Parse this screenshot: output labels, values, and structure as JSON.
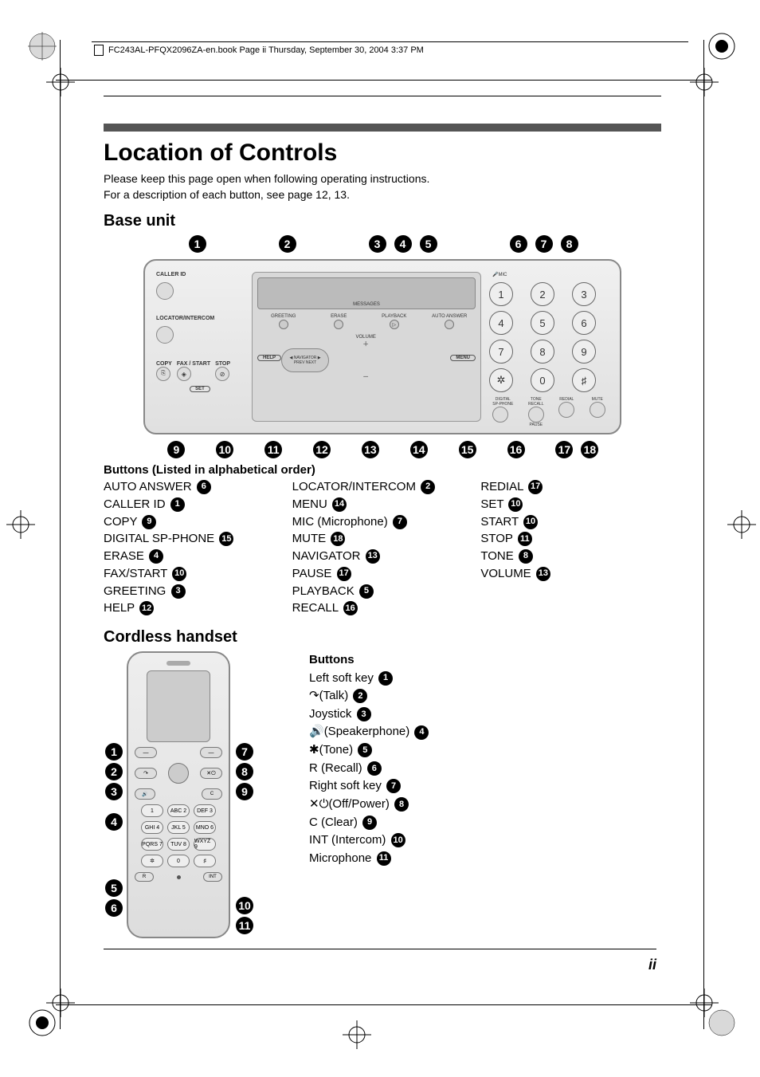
{
  "header": {
    "text": "FC243AL-PFQX2096ZA-en.book  Page ii  Thursday, September 30, 2004  3:37 PM"
  },
  "title": "Location of Controls",
  "intro_line1": "Please keep this page open when following operating instructions.",
  "intro_line2": "For a description of each button, see page 12, 13.",
  "base_unit": {
    "heading": "Base unit",
    "callouts_top": [
      "1",
      "2",
      "3",
      "4",
      "5",
      "6",
      "7",
      "8"
    ],
    "callouts_bottom": [
      "9",
      "10",
      "11",
      "12",
      "13",
      "14",
      "15",
      "16",
      "17",
      "18"
    ],
    "device_labels": {
      "caller_id": "CALLER ID",
      "locator_intercom": "LOCATOR/INTERCOM",
      "copy": "COPY",
      "fax_start": "FAX / START",
      "stop": "STOP",
      "set": "SET",
      "messages": "MESSAGES",
      "greeting": "GREETING",
      "erase": "ERASE",
      "playback": "PLAYBACK",
      "auto_answer": "AUTO ANSWER",
      "help": "HELP",
      "volume": "VOLUME",
      "menu": "MENU",
      "navigator": "NAVIGATOR",
      "prev_next": "PREV        NEXT",
      "mic": "MIC",
      "digital_sp": "DIGITAL",
      "sp_phone": "SP-PHONE",
      "tone_recall": "TONE",
      "recall": "RECALL",
      "redial": "REDIAL",
      "mute": "MUTE",
      "pause": "PAUSE"
    },
    "keypad": [
      "1",
      "2",
      "3",
      "4",
      "5",
      "6",
      "7",
      "8",
      "9",
      "✲",
      "0",
      "♯"
    ],
    "list_title": "Buttons (Listed in alphabetical order)",
    "col1": [
      {
        "label": "AUTO ANSWER",
        "n": "6"
      },
      {
        "label": "CALLER ID",
        "n": "1"
      },
      {
        "label": "COPY",
        "n": "9"
      },
      {
        "label": "DIGITAL SP-PHONE",
        "n": "15"
      },
      {
        "label": "ERASE",
        "n": "4"
      },
      {
        "label": "FAX/START",
        "n": "10"
      },
      {
        "label": "GREETING",
        "n": "3"
      },
      {
        "label": "HELP",
        "n": "12"
      }
    ],
    "col2": [
      {
        "label": "LOCATOR/INTERCOM",
        "n": "2"
      },
      {
        "label": "MENU",
        "n": "14"
      },
      {
        "label": "MIC (Microphone)",
        "n": "7"
      },
      {
        "label": "MUTE",
        "n": "18"
      },
      {
        "label": "NAVIGATOR",
        "n": "13"
      },
      {
        "label": "PAUSE",
        "n": "17"
      },
      {
        "label": "PLAYBACK",
        "n": "5"
      },
      {
        "label": "RECALL",
        "n": "16"
      }
    ],
    "col3": [
      {
        "label": "REDIAL",
        "n": "17"
      },
      {
        "label": "SET",
        "n": "10"
      },
      {
        "label": "START",
        "n": "10"
      },
      {
        "label": "STOP",
        "n": "11"
      },
      {
        "label": "TONE",
        "n": "8"
      },
      {
        "label": "VOLUME",
        "n": "13"
      }
    ]
  },
  "handset": {
    "heading": "Cordless handset",
    "title": "Buttons",
    "callouts_left": [
      "1",
      "2",
      "3",
      "4",
      "5",
      "6"
    ],
    "callouts_right": [
      "7",
      "8",
      "9",
      "10",
      "11"
    ],
    "keypad": [
      "1",
      "ABC 2",
      "DEF 3",
      "GHI 4",
      "JKL 5",
      "MNO 6",
      "PQRS 7",
      "TUV 8",
      "WXYZ 9",
      "✲",
      "0",
      "♯"
    ],
    "r_label": "R",
    "int_label": "INT",
    "items": [
      {
        "label": "Left soft key",
        "n": "1",
        "icon": ""
      },
      {
        "label": "(Talk)",
        "n": "2",
        "icon": "talk"
      },
      {
        "label": "Joystick",
        "n": "3",
        "icon": ""
      },
      {
        "label": "(Speakerphone)",
        "n": "4",
        "icon": "speaker"
      },
      {
        "label": "(Tone)",
        "n": "5",
        "icon": "tone"
      },
      {
        "label": "R (Recall)",
        "n": "6",
        "icon": ""
      },
      {
        "label": "Right soft key",
        "n": "7",
        "icon": ""
      },
      {
        "label": "(Off/Power)",
        "n": "8",
        "icon": "offpower"
      },
      {
        "label": "C (Clear)",
        "n": "9",
        "icon": ""
      },
      {
        "label": "INT (Intercom)",
        "n": "10",
        "icon": ""
      },
      {
        "label": "Microphone",
        "n": "11",
        "icon": ""
      }
    ]
  },
  "page_number": "ii"
}
